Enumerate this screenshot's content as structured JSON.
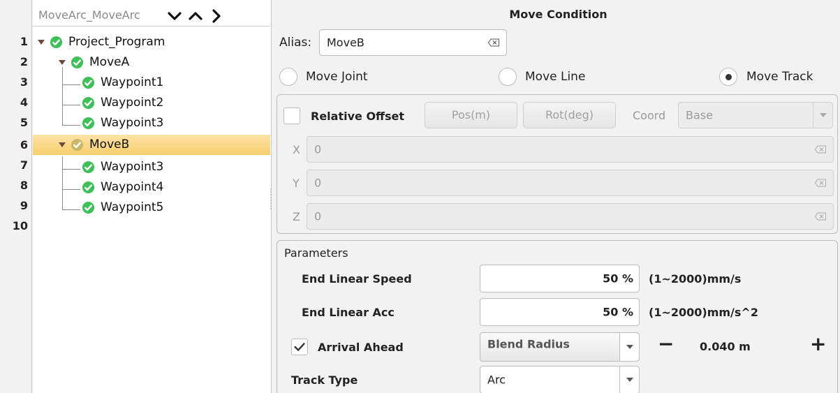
{
  "tree": {
    "title": "MoveArc_MoveArc",
    "line_numbers": [
      "1",
      "2",
      "3",
      "4",
      "5",
      "6",
      "7",
      "8",
      "9",
      "10"
    ],
    "nodes": [
      {
        "label": "Project_Program"
      },
      {
        "label": "MoveA"
      },
      {
        "label": "Waypoint1"
      },
      {
        "label": "Waypoint2"
      },
      {
        "label": "Waypoint3"
      },
      {
        "label": "MoveB"
      },
      {
        "label": "Waypoint3"
      },
      {
        "label": "Waypoint4"
      },
      {
        "label": "Waypoint5"
      }
    ],
    "selected_index": 5
  },
  "condition": {
    "title": "Move Condition",
    "alias_label": "Alias:",
    "alias_value": "MoveB",
    "move_joint": "Move Joint",
    "move_line": "Move Line",
    "move_track": "Move Track",
    "selected_mode": "Move Track"
  },
  "offset": {
    "relative_offset": "Relative Offset",
    "pos_button": "Pos(m)",
    "rot_button": "Rot(deg)",
    "coord_label": "Coord",
    "coord_value": "Base",
    "x_label": "X",
    "x_value": "0",
    "y_label": "Y",
    "y_value": "0",
    "z_label": "Z",
    "z_value": "0"
  },
  "parameters": {
    "title": "Parameters",
    "end_speed_label": "End Linear Speed",
    "end_speed_value": "50 %",
    "end_speed_unit": "(1~2000)mm/s",
    "end_acc_label": "End Linear Acc",
    "end_acc_value": "50 %",
    "end_acc_unit": "(1~2000)mm/s^2",
    "arrival_ahead_label": "Arrival Ahead",
    "arrival_ahead_checked": true,
    "blend_option": "Blend Radius",
    "blend_value": "0.040 m",
    "minus": "−",
    "plus": "+",
    "track_type_label": "Track Type",
    "track_type_value": "Arc"
  },
  "colors": {
    "selection_top": "#fde4a4",
    "selection_bottom": "#f8cd6e",
    "check_green": "#3fbf5a",
    "check_dim": "#c9b86a",
    "caret": "#6b4a3a"
  }
}
